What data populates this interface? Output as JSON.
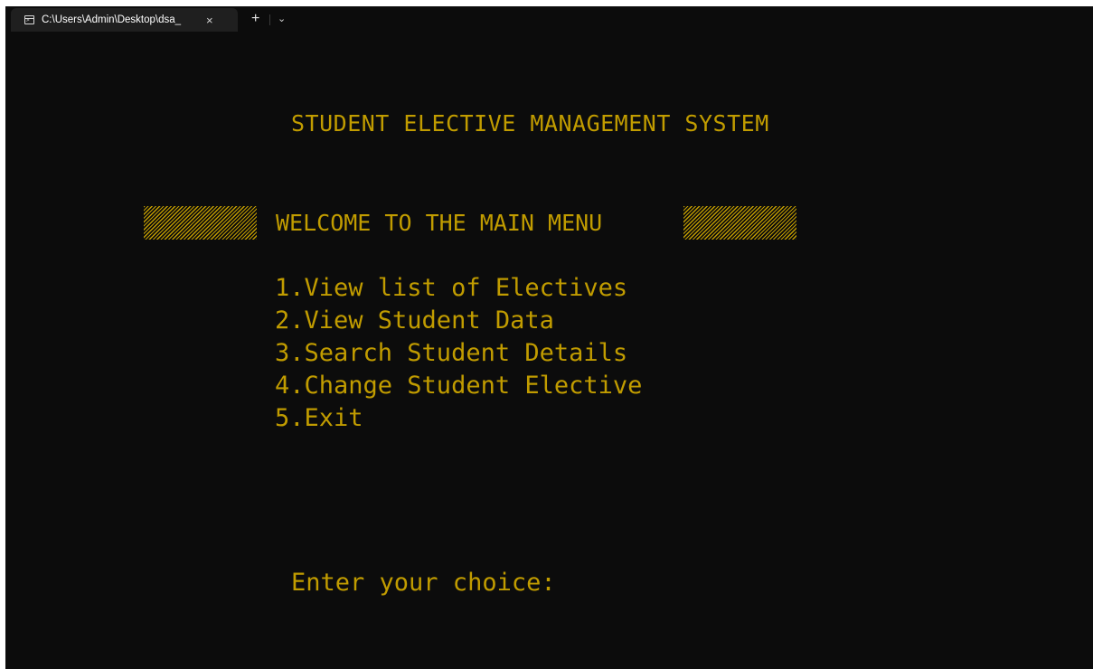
{
  "tab": {
    "title": "C:\\Users\\Admin\\Desktop\\dsa_",
    "close_glyph": "×",
    "new_tab_glyph": "+",
    "dropdown_glyph": "⌄"
  },
  "terminal": {
    "title": "STUDENT ELECTIVE MANAGEMENT SYSTEM",
    "welcome": "WELCOME TO THE MAIN MENU",
    "menu_items": [
      "1.View list of Electives",
      "2.View Student Data",
      "3.Search Student Details",
      "4.Change Student Elective",
      "5.Exit"
    ],
    "prompt": "Enter your choice:",
    "text_color": "#c19c00",
    "background_color": "#0c0c0c"
  }
}
